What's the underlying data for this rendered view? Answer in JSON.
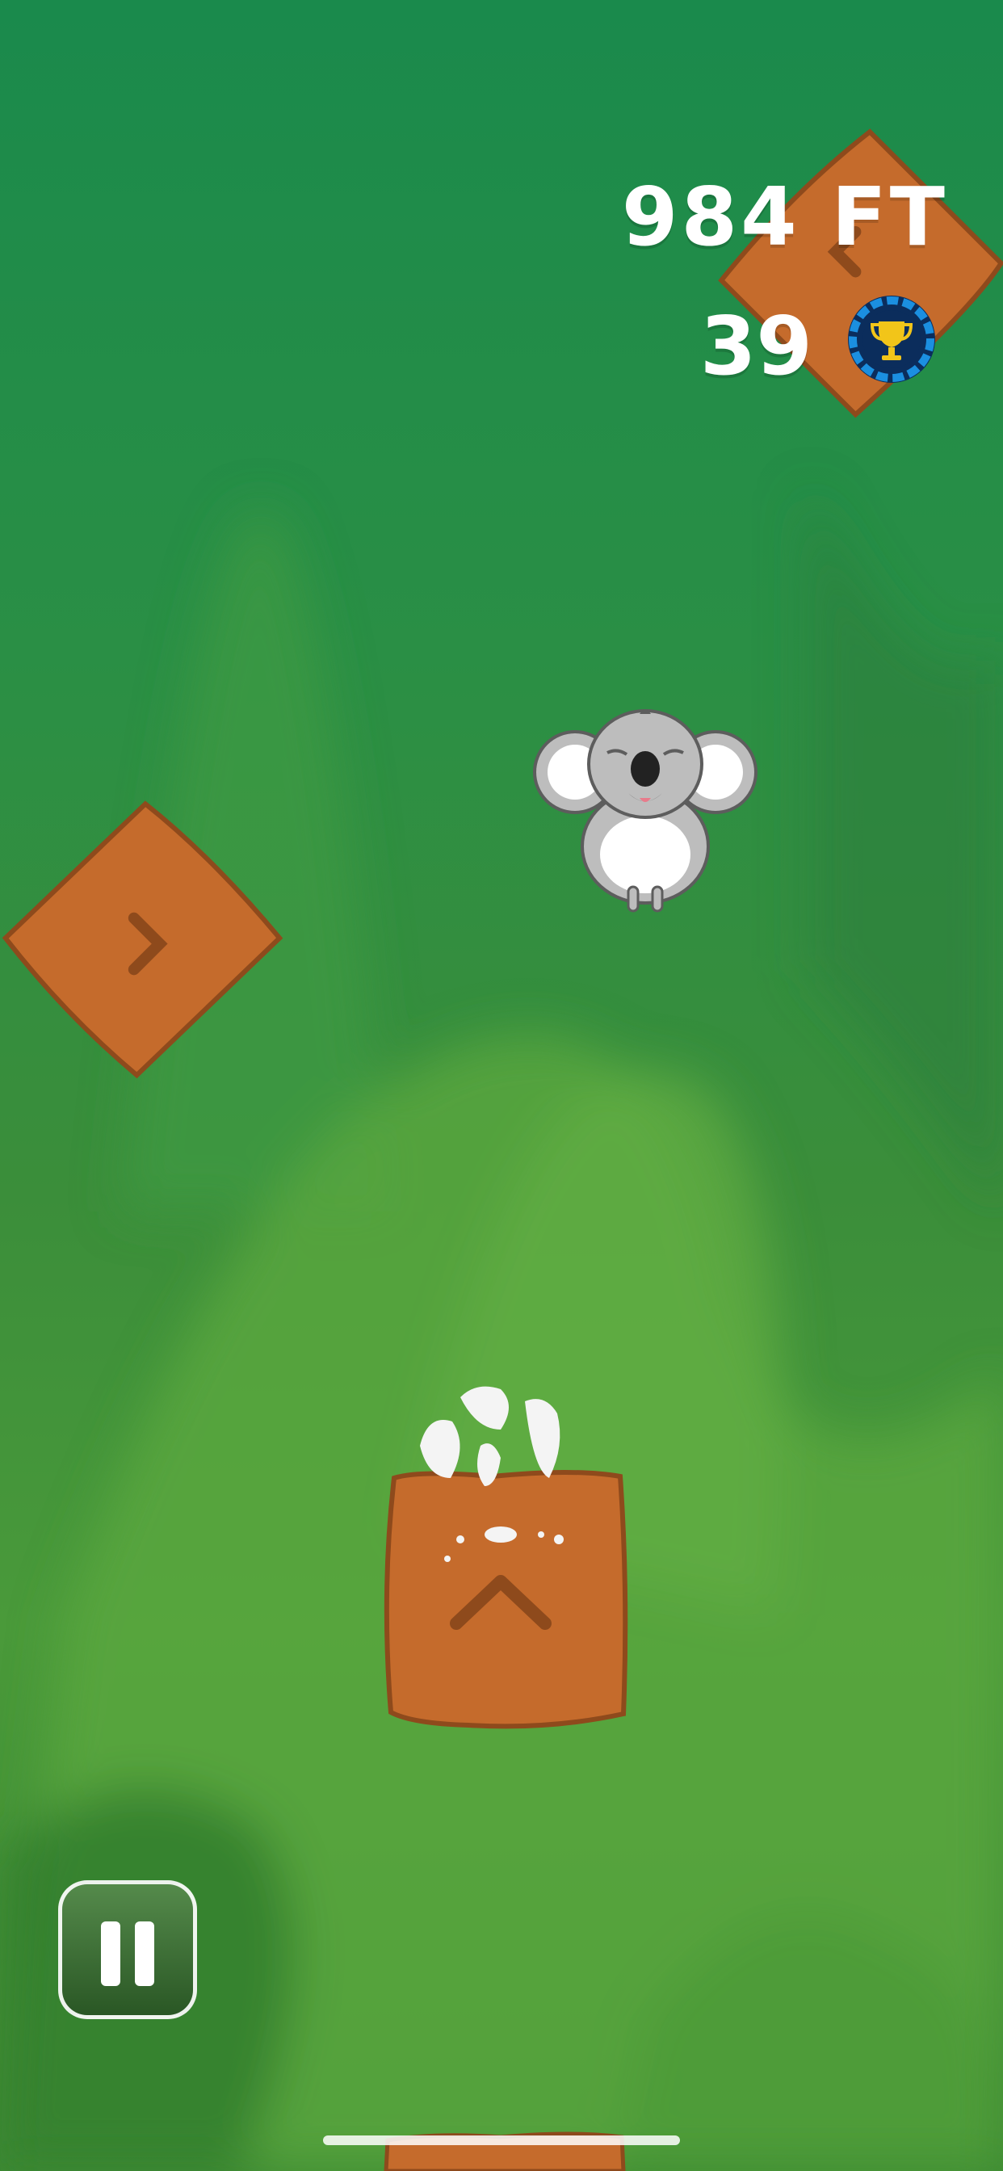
{
  "hud": {
    "distance": "984 FT",
    "score": "39"
  },
  "icons": {
    "score_badge": "trophy-badge-icon",
    "pause": "pause-icon"
  },
  "colors": {
    "bark": "#c56b2c",
    "bark_dark": "#8e4a1c",
    "badge_blue": "#1b8fe0",
    "badge_navy": "#0b2d5c",
    "trophy_gold": "#f2c519"
  }
}
